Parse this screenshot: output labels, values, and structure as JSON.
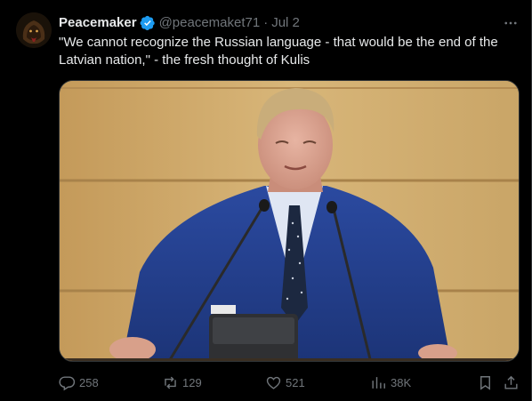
{
  "tweet": {
    "author_name": "Peacemaker",
    "handle": "@peacemaket71",
    "separator": "·",
    "date": "Jul 2",
    "text": "\"We cannot recognize the Russian language - that would be the end of the Latvian nation,\" - the fresh thought of  Kulis",
    "verified_color": "#1d9bf0"
  },
  "actions": {
    "replies": "258",
    "reposts": "129",
    "likes": "521",
    "views": "38K"
  },
  "icons": {
    "verified": "verified-badge-icon",
    "more": "more-options-icon",
    "reply": "reply-icon",
    "repost": "repost-icon",
    "like": "heart-icon",
    "views": "views-chart-icon",
    "bookmark": "bookmark-icon",
    "share": "share-icon"
  },
  "colors": {
    "background": "#000000",
    "text_primary": "#e7e9ea",
    "text_secondary": "#71767b",
    "border": "#2f3336"
  }
}
